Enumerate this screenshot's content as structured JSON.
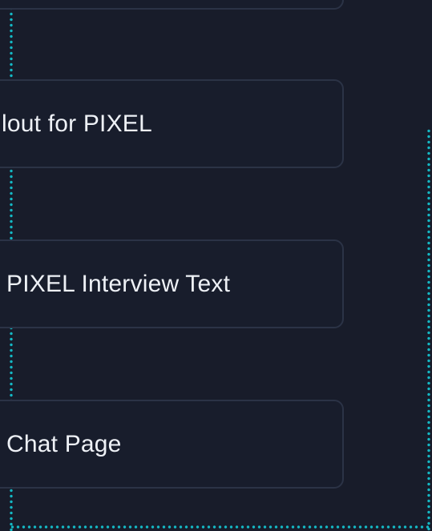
{
  "colors": {
    "background": "#181c2a",
    "node_fill": "#181d2c",
    "node_border": "#2b3346",
    "connector": "#14b8c4",
    "text": "#eef1f6"
  },
  "nodes": [
    {
      "label": ""
    },
    {
      "label": "lout for PIXEL"
    },
    {
      "label": "PIXEL Interview Text"
    },
    {
      "label": "Chat Page"
    }
  ]
}
